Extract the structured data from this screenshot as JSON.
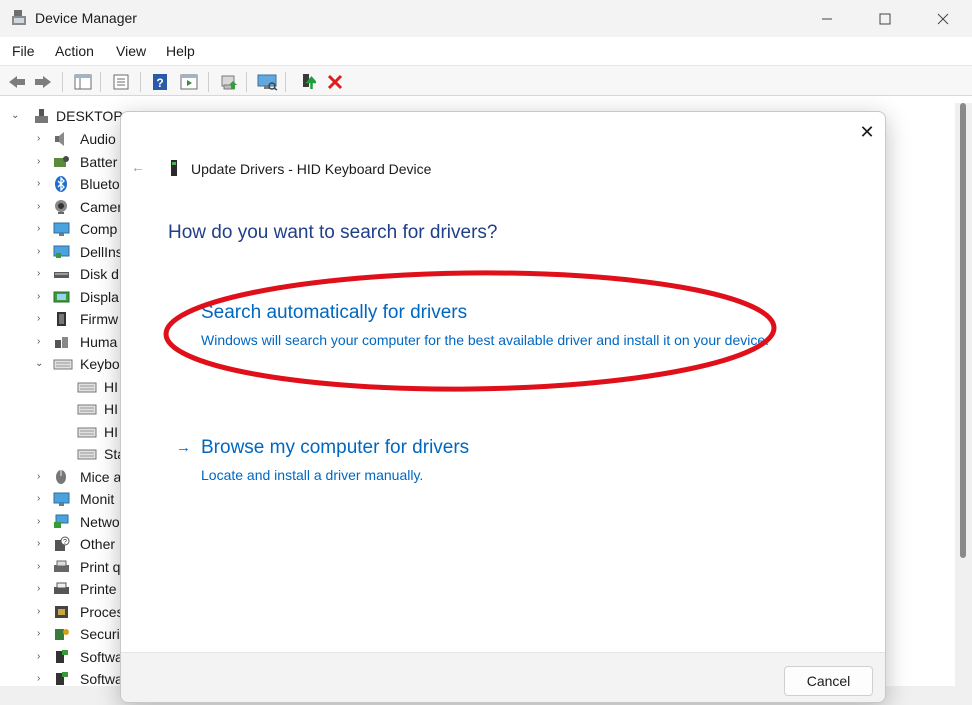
{
  "window": {
    "title": "Device Manager",
    "controls": {
      "minimize": "—",
      "maximize": "☐",
      "close": "✕"
    }
  },
  "menu": [
    "File",
    "Action",
    "View",
    "Help"
  ],
  "toolbar": {
    "icons": [
      "back-icon",
      "forward-icon",
      "show-hide-console-tree-icon",
      "properties-icon",
      "help-icon",
      "run-icon",
      "update-driver-icon",
      "scan-hardware-icon",
      "enable-device-icon",
      "uninstall-device-icon"
    ]
  },
  "tree": {
    "root": "DESKTOP-",
    "items": [
      {
        "label": "Audio",
        "icon": "speaker-icon",
        "expanded": false
      },
      {
        "label": "Batter",
        "icon": "battery-icon",
        "expanded": false
      },
      {
        "label": "Blueto",
        "icon": "bluetooth-icon",
        "expanded": false
      },
      {
        "label": "Camer",
        "icon": "camera-icon",
        "expanded": false
      },
      {
        "label": "Comp",
        "icon": "computer-icon",
        "expanded": false
      },
      {
        "label": "DellIns",
        "icon": "monitor-network-icon",
        "expanded": false
      },
      {
        "label": "Disk d",
        "icon": "disk-drive-icon",
        "expanded": false
      },
      {
        "label": "Displa",
        "icon": "display-adapter-icon",
        "expanded": false
      },
      {
        "label": "Firmw",
        "icon": "firmware-icon",
        "expanded": false
      },
      {
        "label": "Huma",
        "icon": "hid-icon",
        "expanded": false
      },
      {
        "label": "Keybo",
        "icon": "keyboard-icon",
        "expanded": true
      },
      {
        "label": "HI",
        "icon": "keyboard-icon",
        "child": true
      },
      {
        "label": "HI",
        "icon": "keyboard-icon",
        "child": true
      },
      {
        "label": "HI",
        "icon": "keyboard-icon",
        "child": true
      },
      {
        "label": "Sta",
        "icon": "keyboard-icon",
        "child": true
      },
      {
        "label": "Mice a",
        "icon": "mouse-icon",
        "expanded": false
      },
      {
        "label": "Monit",
        "icon": "monitor-icon",
        "expanded": false
      },
      {
        "label": "Netwo",
        "icon": "network-icon",
        "expanded": false
      },
      {
        "label": "Other",
        "icon": "other-devices-icon",
        "expanded": false
      },
      {
        "label": "Print q",
        "icon": "print-queue-icon",
        "expanded": false
      },
      {
        "label": "Printe",
        "icon": "printer-icon",
        "expanded": false
      },
      {
        "label": "Proces",
        "icon": "processor-icon",
        "expanded": false
      },
      {
        "label": "Securi",
        "icon": "security-icon",
        "expanded": false
      },
      {
        "label": "Softwa",
        "icon": "software-icon",
        "expanded": false
      },
      {
        "label": "Softwa",
        "icon": "software-icon",
        "expanded": false
      }
    ]
  },
  "dialog": {
    "title": "Update Drivers - HID Keyboard Device",
    "question": "How do you want to search for drivers?",
    "options": [
      {
        "arrow": "→",
        "title": "Search automatically for drivers",
        "description": "Windows will search your computer for the best available driver and install it on your device."
      },
      {
        "arrow": "→",
        "title": "Browse my computer for drivers",
        "description": "Locate and install a driver manually."
      }
    ],
    "back": "←",
    "close": "✕",
    "cancel_label": "Cancel"
  },
  "colors": {
    "link": "#0067c0",
    "heading": "#1f3f88",
    "annotation": "#e0101a"
  }
}
